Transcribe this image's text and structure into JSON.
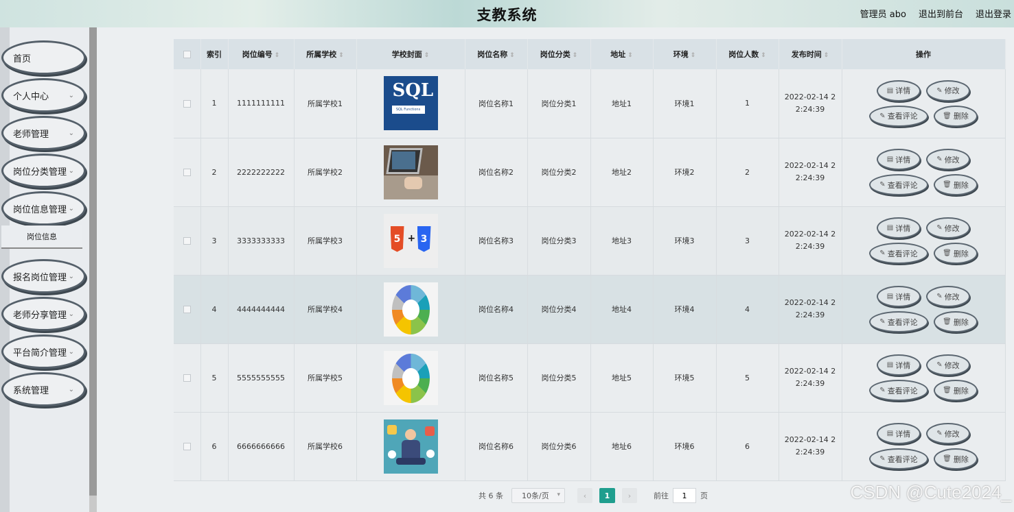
{
  "header": {
    "title": "支教系统",
    "user": "管理员 abo",
    "to_front": "退出到前台",
    "logout": "退出登录"
  },
  "sidebar": {
    "items": [
      {
        "label": "首页",
        "has_arrow": false
      },
      {
        "label": "个人中心",
        "has_arrow": true
      },
      {
        "label": "老师管理",
        "has_arrow": true
      },
      {
        "label": "岗位分类管理",
        "has_arrow": true
      },
      {
        "label": "岗位信息管理",
        "has_arrow": true
      },
      {
        "label": "报名岗位管理",
        "has_arrow": true
      },
      {
        "label": "老师分享管理",
        "has_arrow": true
      },
      {
        "label": "平台简介管理",
        "has_arrow": true
      },
      {
        "label": "系统管理",
        "has_arrow": true
      }
    ],
    "submenu_active": "岗位信息"
  },
  "table": {
    "columns": [
      "索引",
      "岗位编号",
      "所属学校",
      "学校封面",
      "岗位名称",
      "岗位分类",
      "地址",
      "环境",
      "岗位人数",
      "发布时间",
      "操作"
    ],
    "rows": [
      {
        "index": "1",
        "code": "1111111111",
        "school": "所属学校1",
        "cover": "sql",
        "name": "岗位名称1",
        "category": "岗位分类1",
        "address": "地址1",
        "env": "环境1",
        "count": "1",
        "time1": "2022-02-14 2",
        "time2": "2:24:39"
      },
      {
        "index": "2",
        "code": "2222222222",
        "school": "所属学校2",
        "cover": "laptop",
        "name": "岗位名称2",
        "category": "岗位分类2",
        "address": "地址2",
        "env": "环境2",
        "count": "2",
        "time1": "2022-02-14 2",
        "time2": "2:24:39"
      },
      {
        "index": "3",
        "code": "3333333333",
        "school": "所属学校3",
        "cover": "html-css",
        "name": "岗位名称3",
        "category": "岗位分类3",
        "address": "地址3",
        "env": "环境3",
        "count": "3",
        "time1": "2022-02-14 2",
        "time2": "2:24:39"
      },
      {
        "index": "4",
        "code": "4444444444",
        "school": "所属学校4",
        "cover": "wheel",
        "name": "岗位名称4",
        "category": "岗位分类4",
        "address": "地址4",
        "env": "环境4",
        "count": "4",
        "time1": "2022-02-14 2",
        "time2": "2:24:39"
      },
      {
        "index": "5",
        "code": "5555555555",
        "school": "所属学校5",
        "cover": "wheel",
        "name": "岗位名称5",
        "category": "岗位分类5",
        "address": "地址5",
        "env": "环境5",
        "count": "5",
        "time1": "2022-02-14 2",
        "time2": "2:24:39"
      },
      {
        "index": "6",
        "code": "6666666666",
        "school": "所属学校6",
        "cover": "multitask",
        "name": "岗位名称6",
        "category": "岗位分类6",
        "address": "地址6",
        "env": "环境6",
        "count": "6",
        "time1": "2022-02-14 2",
        "time2": "2:24:39"
      }
    ],
    "actions": {
      "detail": "详情",
      "edit": "修改",
      "comments": "查看评论",
      "delete": "删除"
    },
    "cover_text": {
      "sql_title": "SQL",
      "sql_sub": "SQL Functions"
    }
  },
  "pagination": {
    "total": "共 6 条",
    "page_size": "10条/页",
    "current": "1",
    "goto_label": "前往",
    "goto_value": "1",
    "page_suffix": "页"
  },
  "watermark": "CSDN @Cute2024_",
  "colors": {
    "accent": "#1f9e8e",
    "pill_border": "#5b6670"
  }
}
